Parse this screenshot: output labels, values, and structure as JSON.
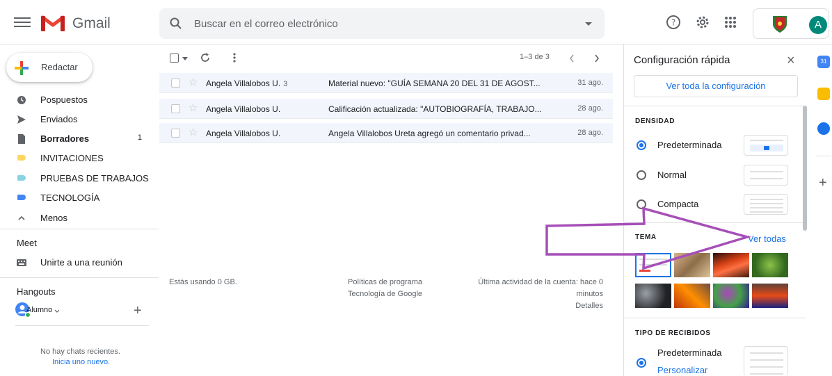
{
  "header": {
    "app_name": "Gmail",
    "search_placeholder": "Buscar en el correo electrónico",
    "account_initial": "A",
    "avatar_color": "#00897b"
  },
  "sidebar": {
    "compose_label": "Redactar",
    "items": [
      {
        "label": "Pospuestos",
        "icon": "clock-icon"
      },
      {
        "label": "Enviados",
        "icon": "send-icon"
      },
      {
        "label": "Borradores",
        "icon": "draft-icon",
        "count": "1",
        "bold": true
      },
      {
        "label": "INVITACIONES",
        "icon": "label-icon",
        "color": "#fdd663"
      },
      {
        "label": "PRUEBAS DE TRABAJOS",
        "icon": "label-icon",
        "color": "#8ad3e3"
      },
      {
        "label": "TECNOLOGÍA",
        "icon": "label-icon",
        "color": "#4285f4"
      },
      {
        "label": "Menos",
        "icon": "chevron-up-icon"
      }
    ],
    "meet_title": "Meet",
    "meet_join": "Unirte a una reunión",
    "hangouts_title": "Hangouts",
    "hangouts_user": "Alumno",
    "no_chats": "No hay chats recientes.",
    "start_new": "Inicia uno nuevo."
  },
  "toolbar": {
    "pagination": "1–3 de 3"
  },
  "emails": [
    {
      "sender": "Angela Villalobos U.",
      "count": "3",
      "subject": "Material nuevo: \"GUÍA SEMANA 20 DEL 31 DE AGOST...",
      "date": "31 ago."
    },
    {
      "sender": "Angela Villalobos U.",
      "count": "",
      "subject": "Calificación actualizada: \"AUTOBIOGRAFÍA, TRABAJO...",
      "date": "28 ago."
    },
    {
      "sender": "Angela Villalobos U.",
      "count": "",
      "subject": "Angela Villalobos Ureta agregó un comentario privad...",
      "date": "28 ago."
    }
  ],
  "footer": {
    "storage": "Estás usando 0 GB.",
    "policies": "Políticas de programa",
    "powered": "Tecnología de Google",
    "activity_1": "Última actividad de la cuenta: hace 0",
    "activity_2": "minutos",
    "details": "Detalles"
  },
  "quick_settings": {
    "title": "Configuración rápida",
    "see_all_settings": "Ver toda la configuración",
    "density_title": "DENSIDAD",
    "density_options": [
      {
        "label": "Predeterminada",
        "selected": true
      },
      {
        "label": "Normal",
        "selected": false
      },
      {
        "label": "Compacta",
        "selected": false
      }
    ],
    "theme_title": "TEMA",
    "see_all_themes": "Ver todas",
    "inbox_type_title": "TIPO DE RECIBIDOS",
    "inbox_default": "Predeterminada",
    "inbox_customize": "Personalizar"
  },
  "colors": {
    "accent": "#1a73e8",
    "arrow": "#9b59b6"
  }
}
